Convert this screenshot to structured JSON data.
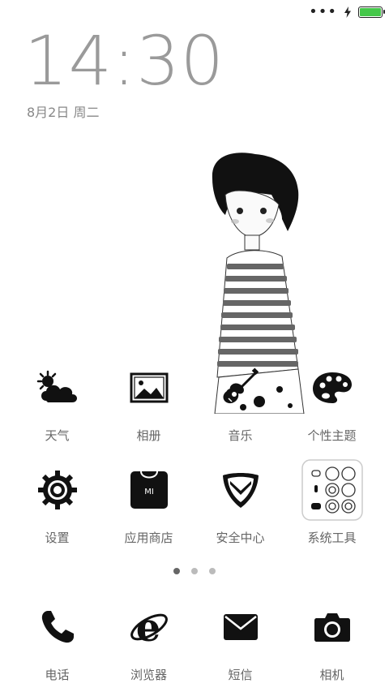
{
  "status_bar": {
    "menu_dots": "•••",
    "battery_color": "#45c84a"
  },
  "clock": {
    "time": "14:30",
    "date": "8月2日 周二"
  },
  "home": {
    "row1": [
      {
        "label": "天气",
        "icon": "weather-icon"
      },
      {
        "label": "相册",
        "icon": "gallery-icon"
      },
      {
        "label": "音乐",
        "icon": "guitar-icon"
      },
      {
        "label": "个性主题",
        "icon": "palette-icon"
      }
    ],
    "row2": [
      {
        "label": "设置",
        "icon": "gear-icon"
      },
      {
        "label": "应用商店",
        "icon": "store-bag-icon",
        "badge": "MI"
      },
      {
        "label": "安全中心",
        "icon": "shield-icon"
      },
      {
        "label": "系统工具",
        "icon": "folder-icon"
      }
    ]
  },
  "pager": {
    "pages": 3,
    "active": 1
  },
  "dock": [
    {
      "label": "电话",
      "icon": "phone-icon"
    },
    {
      "label": "浏览器",
      "icon": "browser-icon"
    },
    {
      "label": "短信",
      "icon": "message-icon"
    },
    {
      "label": "相机",
      "icon": "camera-icon"
    }
  ]
}
